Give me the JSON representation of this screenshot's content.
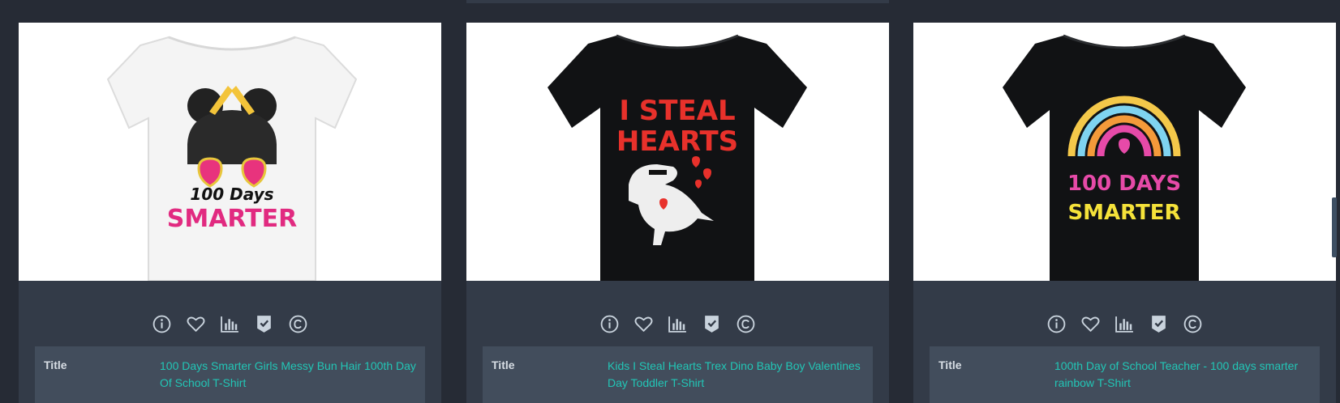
{
  "products": [
    {
      "shirt_color": "#f4f4f4",
      "print_text": [
        "100 Days",
        "SMARTER"
      ],
      "title_label": "Title",
      "title": "100 Days Smarter Girls Messy Bun Hair 100th Day Of School T-Shirt"
    },
    {
      "shirt_color": "#111214",
      "print_text": [
        "I STEAL",
        "HEARTS"
      ],
      "title_label": "Title",
      "title": "Kids I Steal Hearts Trex Dino Baby Boy Valentines Day Toddler T-Shirt"
    },
    {
      "shirt_color": "#111214",
      "print_text": [
        "100 DAYS",
        "SMARTER"
      ],
      "title_label": "Title",
      "title": "100th Day of School Teacher - 100 days smarter rainbow T-Shirt"
    }
  ],
  "action_icons": [
    "info-icon",
    "heart-icon",
    "bar-chart-icon",
    "shield-check-icon",
    "copyright-icon"
  ],
  "colors": {
    "page_bg": "#262b35",
    "card_bg": "#333b48",
    "table_bg": "#424d5c",
    "link": "#22c6b6",
    "icon": "#c9d3dd"
  }
}
